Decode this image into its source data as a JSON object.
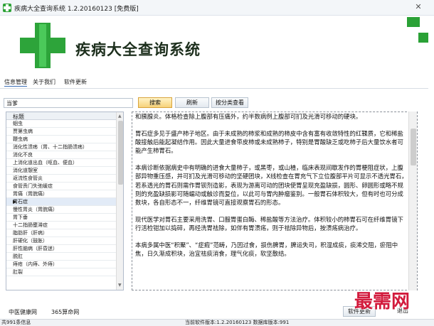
{
  "window": {
    "title": "疾病大全查询系统 1.2.20160123 [免费版]",
    "close_symbol": "✕"
  },
  "banner": {
    "title": "疾病大全查询系统",
    "brand_color": "#2da43a"
  },
  "menu": {
    "items": [
      {
        "label": "信息管理"
      },
      {
        "label": "关于我们"
      },
      {
        "label": "软件更新"
      }
    ]
  },
  "search": {
    "value": "当爹",
    "search_label": "搜索",
    "refresh_label": "刷新",
    "category_label": "按分类查看"
  },
  "list": {
    "header": "标题",
    "items": [
      "蛔虫",
      "贾第虫病",
      "鞭虫病",
      "消化性溃疡（胃、十二指肠溃疡）",
      "消化不良",
      "上消化道出血（呕血、便血）",
      "消化道憩室",
      "返流性食管炎",
      "食管贲门失弛缓症",
      "胃痛（胃脘痛）",
      "胃石症",
      "慢性胃炎（胃脘痛）",
      "胃下垂",
      "十二指肠壅滞症",
      "脂肪肝（肝病）",
      "肝硬化（鼓胀）",
      "肝性脑病（肝昏迷）",
      "脱肛",
      "痔疮（内痔、外痔）",
      "肛裂"
    ],
    "selected_index": 10,
    "selected_marker": "▶"
  },
  "detail": {
    "paragraphs": [
      "和胰腺炎。体格检查除上腹部有压痛外，约半数病例上腹部可扪及光滑可移动的硬块。",
      "胃石症多见于盛产柿子地区。由于未成熟的柿浆和成熟的柿皮中含有富有收敛特性的红鞣质，它和稀盐酸接触后能起凝结作用。因此大量进食带皮柿或未成熟柿子，特别是胃酸缺乏或吃柿子后大量饮水者可能产生柿胃石。",
      "本病诊断依据病史中有明确的进食大量柿子，或黑枣，或山楂，临床表现间歇发作的胃梗阻症状，上腹部异物重压感，并可扪及光滑可移动的坚硬团块，X线检查在胃充气下立位腹部平片可显示不透光胃石，若系透光的胃石则需作胃钡剂造影，表现为游离可动的团块使胃呈现充盈缺损，圆形、卵圆形或略不规则的充盈缺损影可随蠕动或触诊而复位，以此可与胃内肿瘤鉴别。一般胃石体积较大，但有时也可分成数块，各自形态不一，纤维胃镜可直接观察胃石的形态。",
      "现代医学对胃石主要采用洗胃、口服胃蛋白酶、稀盐酸等方法治疗。体积较小的柿胃石可在纤维胃镜下行活检钳加以捣碎，再经洗胃祛除，如伴有胃溃疡，则于祛除异物后，按溃疡病治疗。",
      "本病多属中医“积聚”、“症瘕”范畴，乃因过食，损伤脾胃，脾运失司，积湿成痰，痰浠交阻，瘀阻中焦，日久渐成积块，治宜祛痰消食，理气化痰，软坚散结。"
    ]
  },
  "footer": {
    "link1": "中医健康网",
    "link2": "365算命网",
    "update_label": "软件更新",
    "exit_label": "退出"
  },
  "status": {
    "left": "共991条信息",
    "right": "当前软件版本:1.2.20160123 数据库版本:991"
  },
  "watermark": "最需网"
}
